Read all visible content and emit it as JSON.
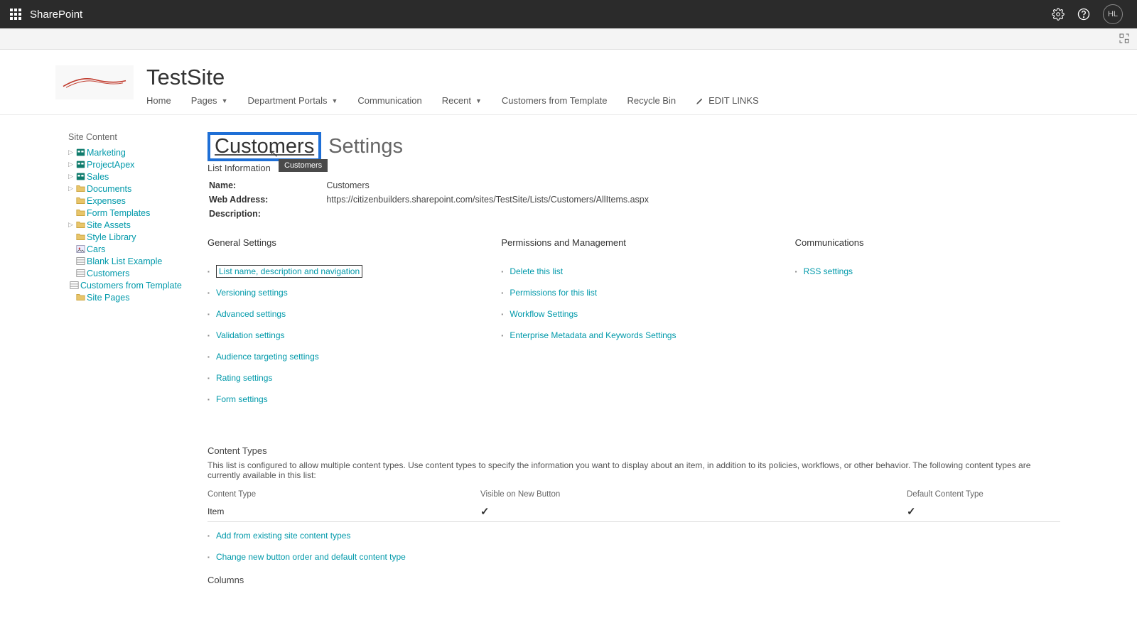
{
  "suiteBar": {
    "appName": "SharePoint",
    "userInitials": "HL"
  },
  "site": {
    "title": "TestSite",
    "nav": [
      {
        "label": "Home",
        "dropdown": false
      },
      {
        "label": "Pages",
        "dropdown": true
      },
      {
        "label": "Department Portals",
        "dropdown": true
      },
      {
        "label": "Communication",
        "dropdown": false
      },
      {
        "label": "Recent",
        "dropdown": true
      },
      {
        "label": "Customers from Template",
        "dropdown": false
      },
      {
        "label": "Recycle Bin",
        "dropdown": false
      }
    ],
    "editLinksLabel": "EDIT LINKS"
  },
  "leftNav": {
    "header": "Site Content",
    "items": [
      {
        "label": "Marketing",
        "expandable": true,
        "icon": "site"
      },
      {
        "label": "ProjectApex",
        "expandable": true,
        "icon": "site"
      },
      {
        "label": "Sales",
        "expandable": true,
        "icon": "site"
      },
      {
        "label": "Documents",
        "expandable": true,
        "icon": "lib"
      },
      {
        "label": "Expenses",
        "expandable": false,
        "icon": "lib"
      },
      {
        "label": "Form Templates",
        "expandable": false,
        "icon": "lib"
      },
      {
        "label": "Site Assets",
        "expandable": true,
        "icon": "lib"
      },
      {
        "label": "Style Library",
        "expandable": false,
        "icon": "lib"
      },
      {
        "label": "Cars",
        "expandable": false,
        "icon": "piclib"
      },
      {
        "label": "Blank List Example",
        "expandable": false,
        "icon": "list"
      },
      {
        "label": "Customers",
        "expandable": false,
        "icon": "list"
      },
      {
        "label": "Customers from Template",
        "expandable": false,
        "icon": "list"
      },
      {
        "label": "Site Pages",
        "expandable": false,
        "icon": "lib"
      }
    ]
  },
  "page": {
    "titleLink": "Customers",
    "titleSuffix": "Settings",
    "tooltip": "Customers",
    "listInfoHeader": "List Information",
    "info": {
      "nameLabel": "Name:",
      "nameValue": "Customers",
      "webLabel": "Web Address:",
      "webValue": "https://citizenbuilders.sharepoint.com/sites/TestSite/Lists/Customers/AllItems.aspx",
      "descLabel": "Description:",
      "descValue": ""
    },
    "groups": {
      "general": {
        "title": "General Settings",
        "links": [
          "List name, description and navigation",
          "Versioning settings",
          "Advanced settings",
          "Validation settings",
          "Audience targeting settings",
          "Rating settings",
          "Form settings"
        ]
      },
      "permissions": {
        "title": "Permissions and Management",
        "links": [
          "Delete this list",
          "Permissions for this list",
          "Workflow Settings",
          "Enterprise Metadata and Keywords Settings"
        ]
      },
      "comms": {
        "title": "Communications",
        "links": [
          "RSS settings"
        ]
      }
    },
    "contentTypes": {
      "header": "Content Types",
      "desc": "This list is configured to allow multiple content types. Use content types to specify the information you want to display about an item, in addition to its policies, workflows, or other behavior. The following content types are currently available in this list:",
      "colContentType": "Content Type",
      "colVisible": "Visible on New Button",
      "colDefault": "Default Content Type",
      "rows": [
        {
          "name": "Item",
          "visible": true,
          "default": true
        }
      ],
      "addLink": "Add from existing site content types",
      "changeLink": "Change new button order and default content type"
    },
    "columnsHeader": "Columns"
  }
}
